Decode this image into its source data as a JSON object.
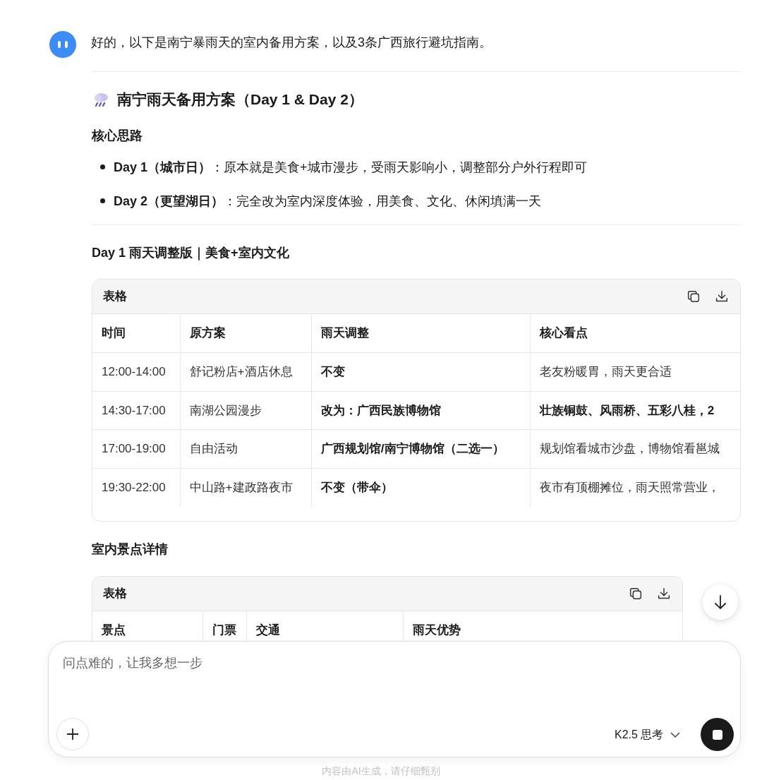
{
  "message": {
    "intro": "好的，以下是南宁暴雨天的室内备用方案，以及3条广西旅行避坑指南。",
    "heading": "南宁雨天备用方案（Day 1 & Day 2）",
    "subheading": "核心思路",
    "bullets": [
      "**Day 1（城市日）**：原本就是美食+城市漫步，受雨天影响小，调整部分户外行程即可",
      "**Day 2（更望湖日）**：完全改为室内深度体验，用美食、文化、休闲填满一天"
    ],
    "section_title": "Day 1 雨天调整版｜美食+室内文化",
    "table_1": {
      "title": "表格",
      "columns": [
        "时间",
        "原方案",
        "雨天调整",
        "核心看点"
      ],
      "rows": [
        {
          "cells": [
            "12:00-14:00",
            "舒记粉店+酒店休息",
            "不变",
            "老友粉暖胃，雨天更合适"
          ],
          "bold": [
            false,
            false,
            true,
            false
          ]
        },
        {
          "cells": [
            "14:30-17:00",
            "南湖公园漫步",
            "改为：广西民族博物馆",
            "壮族铜鼓、风雨桥、五彩八桂，2"
          ],
          "bold": [
            false,
            false,
            true,
            true
          ]
        },
        {
          "cells": [
            "17:00-19:00",
            "自由活动",
            "广西规划馆/南宁博物馆（二选一）",
            "规划馆看城市沙盘，博物馆看邕城"
          ],
          "bold": [
            false,
            false,
            true,
            false
          ]
        },
        {
          "cells": [
            "19:30-22:00",
            "中山路+建政路夜市",
            "不变（带伞）",
            "夜市有顶棚摊位，雨天照常营业，"
          ],
          "bold": [
            false,
            false,
            true,
            false
          ]
        }
      ]
    },
    "section_title_2": "室内景点详情",
    "table_2": {
      "title": "表格",
      "columns": [
        "景点",
        "门票",
        "交通",
        "雨天优势"
      ]
    }
  },
  "composer": {
    "placeholder": "问点难的，让我多想一步",
    "model": "K2.5 思考"
  },
  "footer": "内容由AI生成，请仔细甄别"
}
